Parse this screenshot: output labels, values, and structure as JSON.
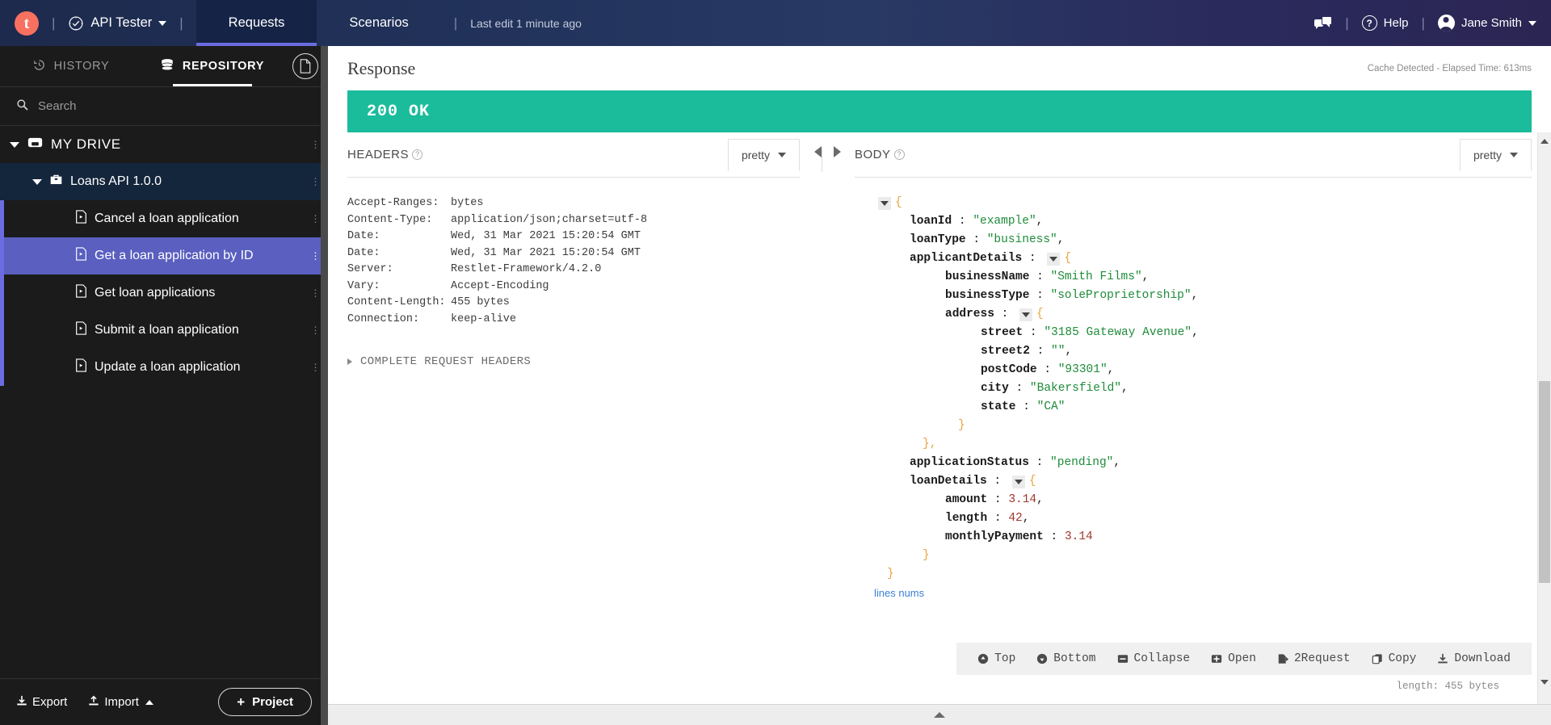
{
  "topbar": {
    "logo_letter": "t",
    "app_name": "API Tester",
    "tabs": [
      {
        "label": "Requests",
        "active": true
      },
      {
        "label": "Scenarios",
        "active": false
      }
    ],
    "last_edit": "Last edit 1 minute ago",
    "help_label": "Help",
    "user_name": "Jane Smith",
    "separator": "|"
  },
  "sidebar": {
    "tabs": [
      {
        "label": "HISTORY",
        "icon": "history-icon",
        "active": false
      },
      {
        "label": "REPOSITORY",
        "icon": "database-icon",
        "active": true
      }
    ],
    "doc_button_icon": "document-icon",
    "search_placeholder": "Search",
    "tree": [
      {
        "label": "MY DRIVE",
        "level": 0,
        "icon": "drive-icon",
        "expanded": true,
        "selected": false
      },
      {
        "label": "Loans API 1.0.0",
        "level": 1,
        "icon": "project-icon",
        "expanded": true,
        "selected": false
      },
      {
        "label": "Cancel a loan application",
        "level": 2,
        "icon": "request-icon",
        "selected": false
      },
      {
        "label": "Get a loan application by ID",
        "level": 2,
        "icon": "request-icon",
        "selected": true
      },
      {
        "label": "Get loan applications",
        "level": 2,
        "icon": "request-icon",
        "selected": false
      },
      {
        "label": "Submit a loan application",
        "level": 2,
        "icon": "request-icon",
        "selected": false
      },
      {
        "label": "Update a loan application",
        "level": 2,
        "icon": "request-icon",
        "selected": false
      }
    ],
    "footer": {
      "export_label": "Export",
      "import_label": "Import",
      "project_label": "Project"
    }
  },
  "response": {
    "title": "Response",
    "cache_meta": "Cache Detected - Elapsed Time: 613ms",
    "status_text": "200 OK",
    "status_color": "#1bbc9b"
  },
  "headers_pane": {
    "title": "HEADERS",
    "format_label": "pretty",
    "rows": [
      {
        "key": "Accept-Ranges:",
        "value": "bytes"
      },
      {
        "key": "Content-Type:",
        "value": "application/json;charset=utf-8"
      },
      {
        "key": "Date:",
        "value": "Wed, 31 Mar 2021 15:20:54 GMT"
      },
      {
        "key": "Date:",
        "value": "Wed, 31 Mar 2021 15:20:54 GMT"
      },
      {
        "key": "Server:",
        "value": "Restlet-Framework/4.2.0"
      },
      {
        "key": "Vary:",
        "value": "Accept-Encoding"
      },
      {
        "key": "Content-Length:",
        "value": "455 bytes"
      },
      {
        "key": "Connection:",
        "value": "keep-alive"
      }
    ],
    "complete_request_headers": "COMPLETE REQUEST HEADERS"
  },
  "body_pane": {
    "title": "BODY",
    "format_label": "pretty",
    "lines_nums_label": "lines nums",
    "length_note": "length: 455 bytes",
    "toolbar": [
      {
        "label": "Top",
        "icon": "arrow-up-circle-icon"
      },
      {
        "label": "Bottom",
        "icon": "arrow-down-circle-icon"
      },
      {
        "label": "Collapse",
        "icon": "collapse-icon"
      },
      {
        "label": "Open",
        "icon": "expand-icon"
      },
      {
        "label": "2Request",
        "icon": "to-request-icon"
      },
      {
        "label": "Copy",
        "icon": "copy-icon"
      },
      {
        "label": "Download",
        "icon": "download-icon"
      }
    ],
    "json_lines": [
      {
        "indent": 0,
        "toggle": true,
        "parts": [
          {
            "t": "brace",
            "v": "{"
          }
        ]
      },
      {
        "indent": 1,
        "parts": [
          {
            "t": "key",
            "v": "loanId"
          },
          {
            "t": "plain",
            "v": " : "
          },
          {
            "t": "str",
            "v": "\"example\""
          },
          {
            "t": "plain",
            "v": ","
          }
        ]
      },
      {
        "indent": 1,
        "parts": [
          {
            "t": "key",
            "v": "loanType"
          },
          {
            "t": "plain",
            "v": " : "
          },
          {
            "t": "str",
            "v": "\"business\""
          },
          {
            "t": "plain",
            "v": ","
          }
        ]
      },
      {
        "indent": 1,
        "toggle": true,
        "parts": [
          {
            "t": "key",
            "v": "applicantDetails"
          },
          {
            "t": "plain",
            "v": " : "
          }
        ],
        "after": "{"
      },
      {
        "indent": 2,
        "parts": [
          {
            "t": "key",
            "v": "businessName"
          },
          {
            "t": "plain",
            "v": " : "
          },
          {
            "t": "str",
            "v": "\"Smith Films\""
          },
          {
            "t": "plain",
            "v": ","
          }
        ]
      },
      {
        "indent": 2,
        "parts": [
          {
            "t": "key",
            "v": "businessType"
          },
          {
            "t": "plain",
            "v": " : "
          },
          {
            "t": "str",
            "v": "\"soleProprietorship\""
          },
          {
            "t": "plain",
            "v": ","
          }
        ]
      },
      {
        "indent": 2,
        "toggle": true,
        "parts": [
          {
            "t": "key",
            "v": "address"
          },
          {
            "t": "plain",
            "v": " : "
          }
        ],
        "after": "{"
      },
      {
        "indent": 3,
        "parts": [
          {
            "t": "key",
            "v": "street"
          },
          {
            "t": "plain",
            "v": " : "
          },
          {
            "t": "str",
            "v": "\"3185 Gateway Avenue\""
          },
          {
            "t": "plain",
            "v": ","
          }
        ]
      },
      {
        "indent": 3,
        "parts": [
          {
            "t": "key",
            "v": "street2"
          },
          {
            "t": "plain",
            "v": " : "
          },
          {
            "t": "str",
            "v": "\"\""
          },
          {
            "t": "plain",
            "v": ","
          }
        ]
      },
      {
        "indent": 3,
        "parts": [
          {
            "t": "key",
            "v": "postCode"
          },
          {
            "t": "plain",
            "v": " : "
          },
          {
            "t": "str",
            "v": "\"93301\""
          },
          {
            "t": "plain",
            "v": ","
          }
        ]
      },
      {
        "indent": 3,
        "parts": [
          {
            "t": "key",
            "v": "city"
          },
          {
            "t": "plain",
            "v": " : "
          },
          {
            "t": "str",
            "v": "\"Bakersfield\""
          },
          {
            "t": "plain",
            "v": ","
          }
        ]
      },
      {
        "indent": 3,
        "parts": [
          {
            "t": "key",
            "v": "state"
          },
          {
            "t": "plain",
            "v": " : "
          },
          {
            "t": "str",
            "v": "\"CA\""
          }
        ]
      },
      {
        "indent": 2,
        "parts": [
          {
            "t": "brace",
            "v": "}"
          }
        ]
      },
      {
        "indent": 1,
        "parts": [
          {
            "t": "brace",
            "v": "},"
          }
        ]
      },
      {
        "indent": 1,
        "parts": [
          {
            "t": "key",
            "v": "applicationStatus"
          },
          {
            "t": "plain",
            "v": " : "
          },
          {
            "t": "str",
            "v": "\"pending\""
          },
          {
            "t": "plain",
            "v": ","
          }
        ]
      },
      {
        "indent": 1,
        "toggle": true,
        "parts": [
          {
            "t": "key",
            "v": "loanDetails"
          },
          {
            "t": "plain",
            "v": " : "
          }
        ],
        "after": "{"
      },
      {
        "indent": 2,
        "parts": [
          {
            "t": "key",
            "v": "amount"
          },
          {
            "t": "plain",
            "v": " : "
          },
          {
            "t": "num",
            "v": "3.14"
          },
          {
            "t": "plain",
            "v": ","
          }
        ]
      },
      {
        "indent": 2,
        "parts": [
          {
            "t": "key",
            "v": "length"
          },
          {
            "t": "plain",
            "v": " : "
          },
          {
            "t": "num",
            "v": "42"
          },
          {
            "t": "plain",
            "v": ","
          }
        ]
      },
      {
        "indent": 2,
        "parts": [
          {
            "t": "key",
            "v": "monthlyPayment"
          },
          {
            "t": "plain",
            "v": " : "
          },
          {
            "t": "num",
            "v": "3.14"
          }
        ]
      },
      {
        "indent": 1,
        "parts": [
          {
            "t": "brace",
            "v": "}"
          }
        ]
      },
      {
        "indent": 0,
        "parts": [
          {
            "t": "brace",
            "v": "}"
          }
        ]
      }
    ]
  }
}
